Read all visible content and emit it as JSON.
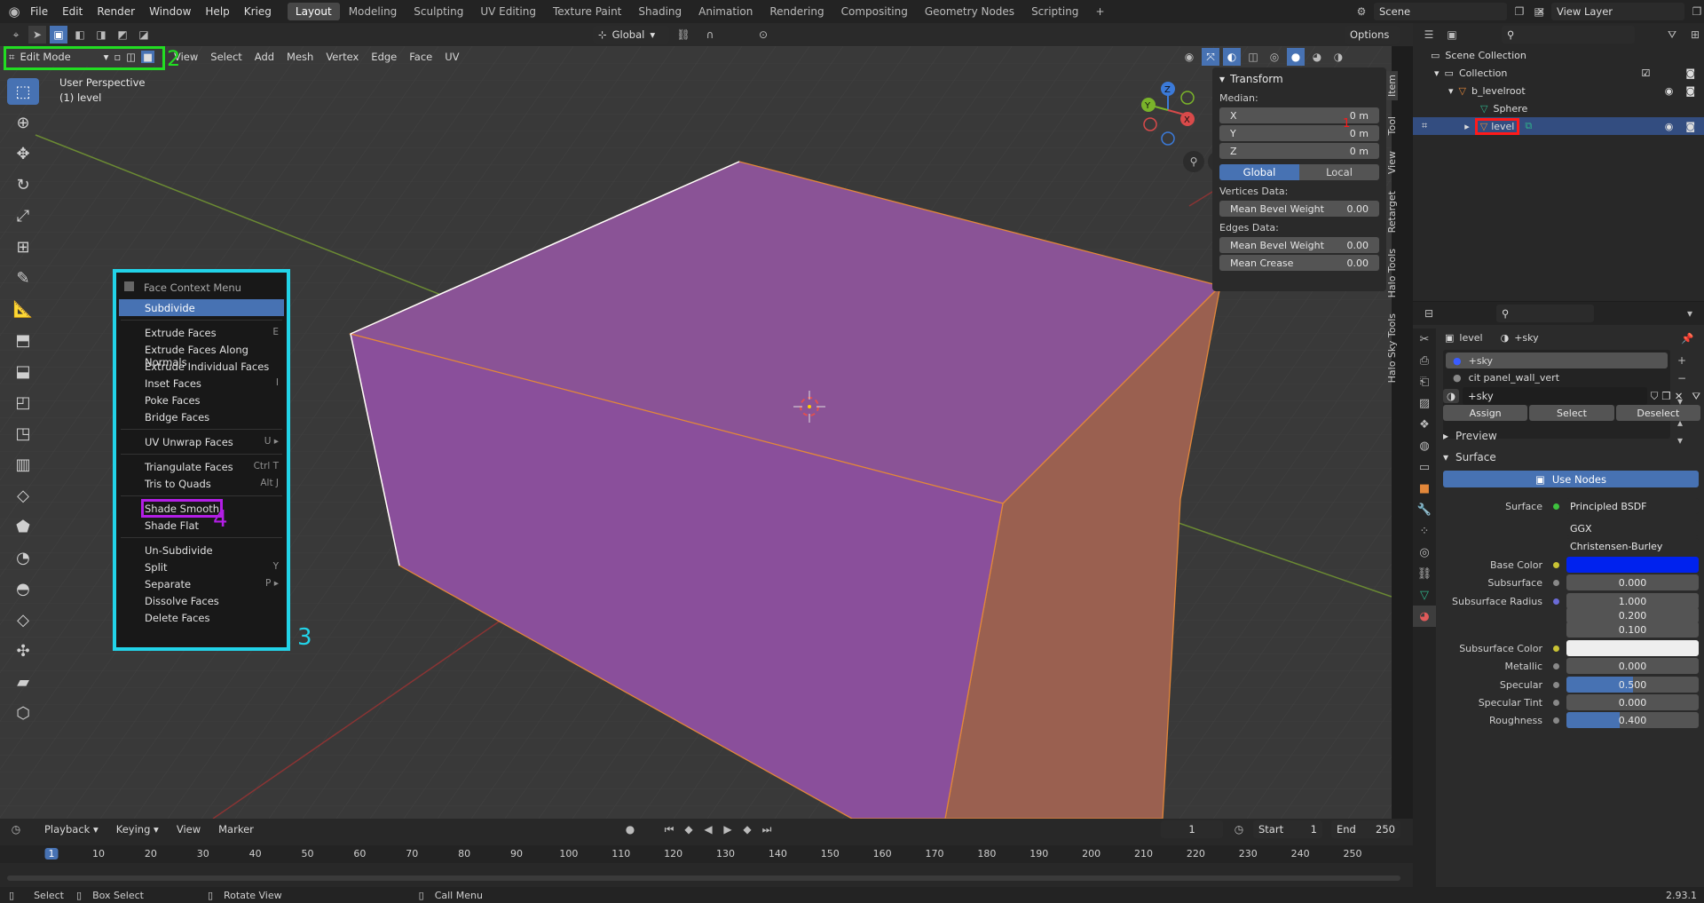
{
  "topbar": {
    "menus": [
      "File",
      "Edit",
      "Render",
      "Window",
      "Help",
      "Krieg"
    ],
    "workspaces": [
      "Layout",
      "Modeling",
      "Sculpting",
      "UV Editing",
      "Texture Paint",
      "Shading",
      "Animation",
      "Rendering",
      "Compositing",
      "Geometry Nodes",
      "Scripting"
    ],
    "active_workspace": "Layout",
    "add_tab": "+",
    "scene": "Scene",
    "view_layer": "View Layer"
  },
  "header": {
    "mode": "Edit Mode",
    "menus": [
      "View",
      "Select",
      "Add",
      "Mesh",
      "Vertex",
      "Edge",
      "Face",
      "UV"
    ],
    "orientation": "Global",
    "options": "Options"
  },
  "viewport": {
    "perspective": "User Perspective",
    "object": "(1) level",
    "gizmo": {
      "x": "X",
      "y": "Y",
      "z": "Z"
    }
  },
  "context_menu": {
    "title": "Face Context Menu",
    "items": [
      {
        "label": "Subdivide",
        "shortcut": ""
      },
      {
        "label": "Extrude Faces",
        "shortcut": "E"
      },
      {
        "label": "Extrude Faces Along Normals",
        "shortcut": ""
      },
      {
        "label": "Extrude Individual Faces",
        "shortcut": ""
      },
      {
        "label": "Inset Faces",
        "shortcut": "I"
      },
      {
        "label": "Poke Faces",
        "shortcut": ""
      },
      {
        "label": "Bridge Faces",
        "shortcut": ""
      },
      {
        "label": "UV Unwrap Faces",
        "shortcut": "U ▸"
      },
      {
        "label": "Triangulate Faces",
        "shortcut": "Ctrl T"
      },
      {
        "label": "Tris to Quads",
        "shortcut": "Alt J"
      },
      {
        "label": "Shade Smooth",
        "shortcut": ""
      },
      {
        "label": "Shade Flat",
        "shortcut": ""
      },
      {
        "label": "Un-Subdivide",
        "shortcut": ""
      },
      {
        "label": "Split",
        "shortcut": "Y"
      },
      {
        "label": "Separate",
        "shortcut": "P ▸"
      },
      {
        "label": "Dissolve Faces",
        "shortcut": ""
      },
      {
        "label": "Delete Faces",
        "shortcut": ""
      }
    ]
  },
  "annotations": {
    "n1": "1",
    "n2": "2",
    "n3": "3",
    "n4": "4"
  },
  "npanel": {
    "title": "Transform",
    "median": "Median:",
    "x_label": "X",
    "x": "0 m",
    "y_label": "Y",
    "y": "0 m",
    "z_label": "Z",
    "z": "0 m",
    "global": "Global",
    "local": "Local",
    "vertices_data": "Vertices Data:",
    "mean_bevel_weight": "Mean Bevel Weight",
    "v_bevel": "0.00",
    "edges_data": "Edges Data:",
    "e_bevel": "0.00",
    "mean_crease": "Mean Crease",
    "crease": "0.00",
    "tabs": [
      "Item",
      "Tool",
      "View",
      "Retarget",
      "Halo Tools",
      "Halo Sky Tools"
    ]
  },
  "outliner": {
    "scene_collection": "Scene Collection",
    "collection": "Collection",
    "levelroot": "b_levelroot",
    "sphere": "Sphere",
    "level": "level"
  },
  "properties": {
    "breadcrumb_obj": "level",
    "breadcrumb_mat": "+sky",
    "slots": [
      "+sky",
      "cit panel_wall_vert"
    ],
    "material_name": "+sky",
    "assign": "Assign",
    "select": "Select",
    "deselect": "Deselect",
    "preview": "Preview",
    "surface_panel": "Surface",
    "use_nodes": "Use Nodes",
    "surface_label": "Surface",
    "surface": "Principled BSDF",
    "distribution": "GGX",
    "subsurface_method": "Christensen-Burley",
    "base_color_label": "Base Color",
    "base_color": "#0022ee",
    "subsurface_label": "Subsurface",
    "subsurface": "0.000",
    "subsurface_radius_label": "Subsurface Radius",
    "sr1": "1.000",
    "sr2": "0.200",
    "sr3": "0.100",
    "subsurface_color_label": "Subsurface Color",
    "subsurface_color": "#eeeeee",
    "metallic_label": "Metallic",
    "metallic": "0.000",
    "specular_label": "Specular",
    "specular": "0.500",
    "specular_frac": 0.5,
    "specular_tint_label": "Specular Tint",
    "specular_tint": "0.000",
    "roughness_label": "Roughness",
    "roughness": "0.400",
    "roughness_frac": 0.4
  },
  "timeline": {
    "menus": [
      "Playback",
      "Keying",
      "View",
      "Marker"
    ],
    "current": "1",
    "start_label": "Start",
    "start": "1",
    "end_label": "End",
    "end": "250",
    "ticks": [
      "1",
      "10",
      "20",
      "30",
      "40",
      "50",
      "60",
      "70",
      "80",
      "90",
      "100",
      "110",
      "120",
      "130",
      "140",
      "150",
      "160",
      "170",
      "180",
      "190",
      "200",
      "210",
      "220",
      "230",
      "240",
      "250"
    ]
  },
  "statusbar": {
    "select": "Select",
    "box_select": "Box Select",
    "rotate": "Rotate View",
    "call_menu": "Call Menu",
    "version": "2.93.1"
  },
  "colors": {
    "accent": "#4772b3",
    "face": "#8a4f9b",
    "edge": "#e2873a",
    "annot_red": "#ff1a1a",
    "annot_green": "#22dd22",
    "annot_cyan": "#22d3e8",
    "annot_purple": "#b31ee6"
  }
}
